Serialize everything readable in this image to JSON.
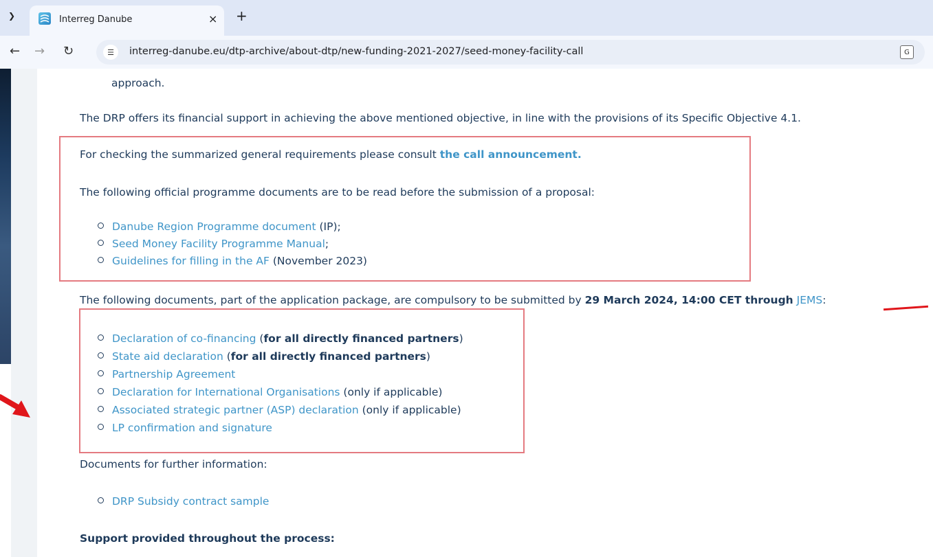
{
  "browser": {
    "tab_title": "Interreg Danube",
    "close_glyph": "×",
    "newtab_glyph": "+",
    "url": "interreg-danube.eu/dtp-archive/about-dtp/new-funding-2021-2027/seed-money-facility-call"
  },
  "content": {
    "approach": "approach.",
    "drp_offers": "The DRP offers its financial support in achieving the above mentioned objective, in line with the provisions of its Specific Objective 4.1.",
    "checking_prefix": "For checking the summarized general requirements please consult ",
    "checking_link": "the call announcement.",
    "official_docs_intro": "The following official programme documents are to be read before the submission of a proposal:",
    "official_docs": [
      {
        "link": "Danube Region Programme document",
        "suffix": " (IP);"
      },
      {
        "link": "Seed Money Facility Programme Manual",
        "suffix": ";"
      },
      {
        "link": "Guidelines for filling in the AF",
        "suffix": " (November 2023)"
      }
    ],
    "package_intro_prefix": "The following documents, part of the application package, are compulsory to be submitted by ",
    "package_deadline": "29 March 2024, 14:00 CET through",
    "package_link": "JEMS",
    "package_suffix": ":",
    "package_docs": [
      {
        "link": "Declaration of co-financing",
        "open": " (",
        "bold": "for all directly financed partners",
        "close": ")"
      },
      {
        "link": "State aid declaration",
        "open": " (",
        "bold": "for all directly financed partners",
        "close": ")"
      },
      {
        "link": "Partnership Agreement",
        "open": "",
        "bold": "",
        "close": ""
      },
      {
        "link": "Declaration for International Organisations",
        "open": " (only if applicable)",
        "bold": "",
        "close": ""
      },
      {
        "link": "Associated strategic partner (ASP) declaration",
        "open": " (only if applicable)",
        "bold": "",
        "close": ""
      },
      {
        "link": "LP confirmation and signature",
        "open": "",
        "bold": "",
        "close": ""
      }
    ],
    "further_info_intro": "Documents for further information:",
    "further_docs": [
      "DRP Subsidy contract sample"
    ],
    "support_heading": "Support provided throughout the process:"
  },
  "colors": {
    "text": "#1e3a5a",
    "link": "#3f95c8",
    "annotation_red": "#e47a80",
    "arrow_red": "#e0161b"
  }
}
